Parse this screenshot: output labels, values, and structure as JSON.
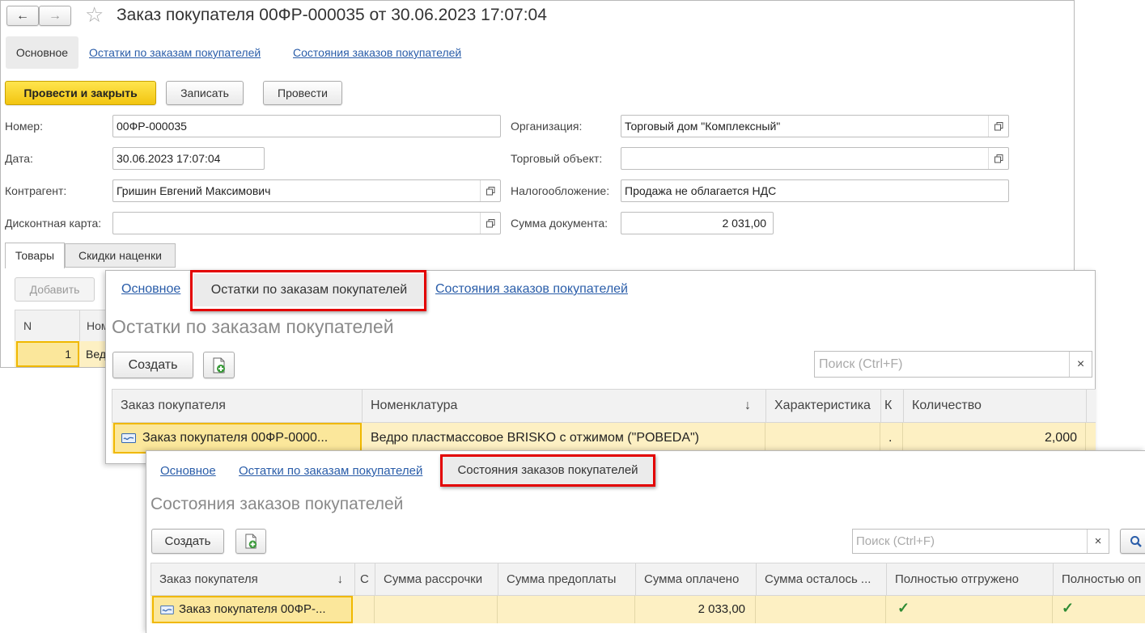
{
  "main": {
    "title": "Заказ покупателя 00ФР-000035 от 30.06.2023 17:07:04",
    "nav": {
      "back": "←",
      "forward": "→",
      "favorite": "☆"
    },
    "sections": [
      "Основное",
      "Остатки по заказам покупателей",
      "Состояния заказов покупателей"
    ],
    "toolbar": {
      "post_close": "Провести и закрыть",
      "save": "Записать",
      "post": "Провести"
    },
    "fields": {
      "number_label": "Номер:",
      "number": "00ФР-000035",
      "date_label": "Дата:",
      "date": "30.06.2023 17:07:04",
      "counterparty_label": "Контрагент:",
      "counterparty": "Гришин Евгений Максимович",
      "card_label": "Дисконтная карта:",
      "card": "",
      "org_label": "Организация:",
      "org": "Торговый дом \"Комплексный\"",
      "store_label": "Торговый объект:",
      "store": "",
      "tax_label": "Налогообложение:",
      "tax": "Продажа не облагается НДС",
      "sum_label": "Сумма документа:",
      "sum": "2 031,00"
    },
    "tabs": [
      "Товары",
      "Скидки наценки"
    ],
    "goods": {
      "add": "Добавить",
      "col_n": "N",
      "col_name": "Ном",
      "row_n": "1",
      "row_name": "Вед"
    }
  },
  "balances": {
    "sections": [
      "Основное",
      "Остатки по заказам покупателей",
      "Состояния заказов покупателей"
    ],
    "heading": "Остатки по заказам покупателей",
    "create": "Создать",
    "search_placeholder": "Поиск (Ctrl+F)",
    "clear": "×",
    "columns": [
      "Заказ покупателя",
      "Номенклатура",
      "Характеристика",
      "К",
      "Количество"
    ],
    "sort_arrow": "↓",
    "row": {
      "order": "Заказ покупателя 00ФР-0000...",
      "item": "Ведро пластмассовое BRISKO с отжимом (\"POBEDA\")",
      "characteristic": "",
      "k": ".",
      "quantity": "2,000"
    }
  },
  "states": {
    "sections": [
      "Основное",
      "Остатки по заказам покупателей",
      "Состояния заказов покупателей"
    ],
    "heading": "Состояния заказов покупателей",
    "create": "Создать",
    "search_placeholder": "Поиск (Ctrl+F)",
    "clear": "×",
    "columns": [
      "Заказ покупателя",
      "С",
      "Сумма рассрочки",
      "Сумма предоплаты",
      "Сумма оплачено",
      "Сумма осталось ...",
      "Полностью отгружено",
      "Полностью оп"
    ],
    "sort_arrow": "↓",
    "row": {
      "order": "Заказ покупателя 00ФР-...",
      "paid": "2 033,00",
      "shipped_check": "✓",
      "paid_full_check": "✓"
    }
  },
  "colors": {
    "accent_yellow": "#f5c818",
    "link_blue": "#2a5da9",
    "highlight_red": "#e30000",
    "row_yellow": "#fdf0c3"
  }
}
